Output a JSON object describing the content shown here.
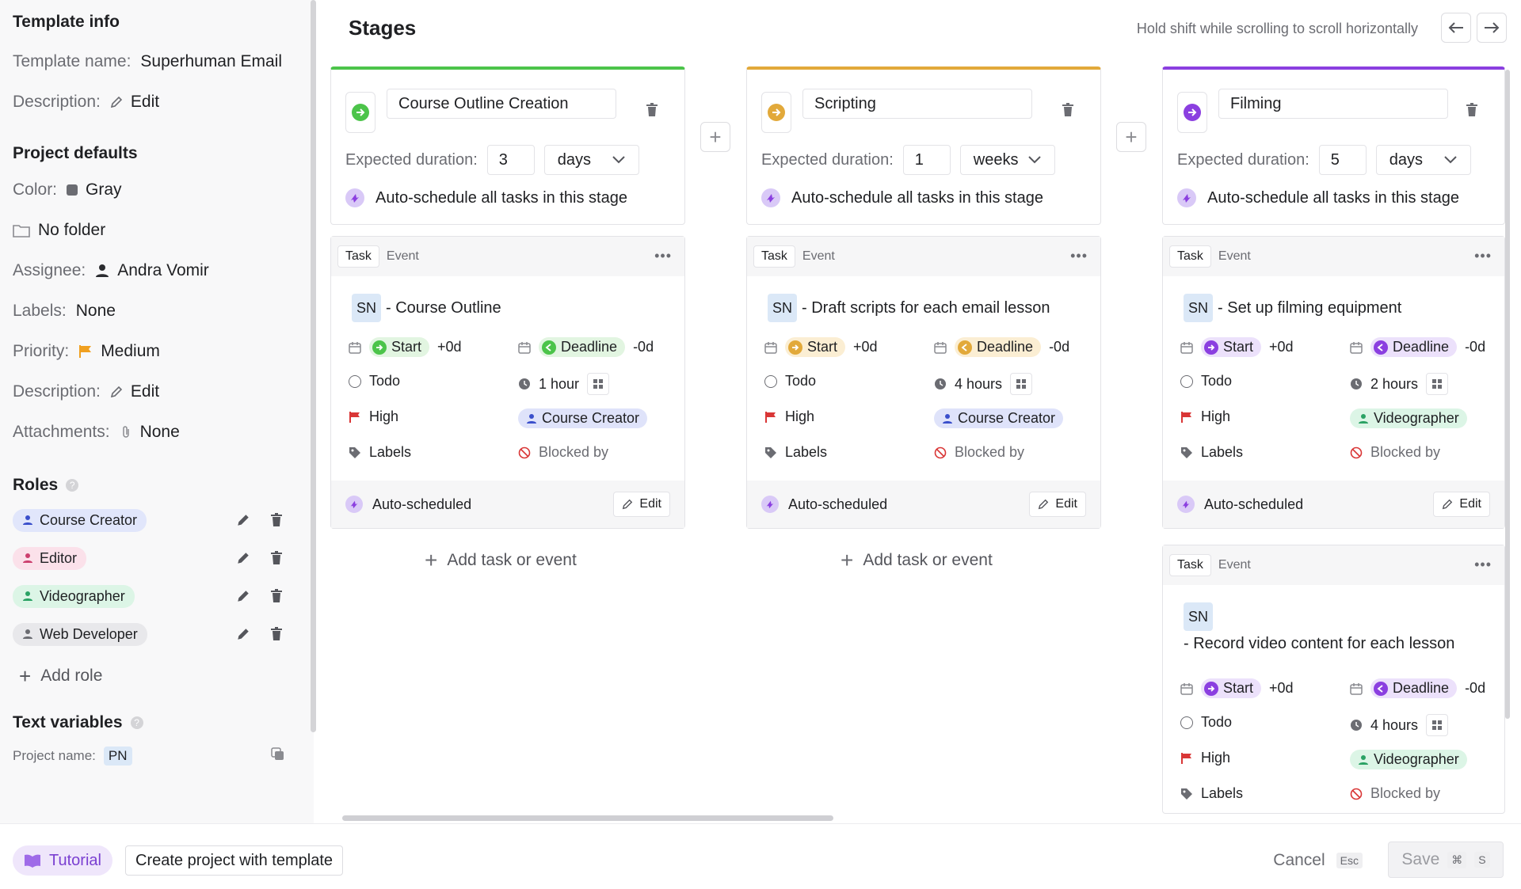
{
  "sidebar": {
    "template_info_heading": "Template info",
    "template_name_label": "Template name:",
    "template_name_value": "Superhuman Email",
    "description_label": "Description:",
    "description_edit": "Edit",
    "project_defaults_heading": "Project defaults",
    "color_label": "Color:",
    "color_value": "Gray",
    "folder_value": "No folder",
    "assignee_label": "Assignee:",
    "assignee_value": "Andra Vomir",
    "labels_label": "Labels:",
    "labels_value": "None",
    "priority_label": "Priority:",
    "priority_value": "Medium",
    "description2_label": "Description:",
    "description2_edit": "Edit",
    "attachments_label": "Attachments:",
    "attachments_value": "None",
    "roles_heading": "Roles",
    "roles": [
      {
        "name": "Course Creator",
        "bg": "#e1e6fb",
        "fg": "#3a4fcb"
      },
      {
        "name": "Editor",
        "bg": "#fbe1ea",
        "fg": "#cc3f6e"
      },
      {
        "name": "Videographer",
        "bg": "#dcf5e6",
        "fg": "#2aa264"
      },
      {
        "name": "Web Developer",
        "bg": "#e8e8eb",
        "fg": "#6b6c72"
      }
    ],
    "add_role": "Add role",
    "text_variables_heading": "Text variables",
    "project_name_label": "Project name:",
    "project_name_value": "PN"
  },
  "main": {
    "title": "Stages",
    "hint": "Hold shift while scrolling to scroll horizontally",
    "duration_label": "Expected duration:",
    "auto_schedule_text": "Auto-schedule all tasks in this stage",
    "add_task_label": "Add task or event",
    "task_tab": "Task",
    "event_tab": "Event",
    "stages": [
      {
        "name": "Course Outline Creation",
        "color": "#4cc44a",
        "duration": "3",
        "unit": "days",
        "cards": [
          {
            "sn": "SN",
            "title": "- Course Outline",
            "start": "Start",
            "start_off": "+0d",
            "deadline": "Deadline",
            "deadline_off": "-0d",
            "status": "Todo",
            "duration": "1 hour",
            "priority": "High",
            "role": "Course Creator",
            "labels": "Labels",
            "blocked": "Blocked by",
            "auto": "Auto-scheduled",
            "edit": "Edit"
          }
        ]
      },
      {
        "name": "Scripting",
        "color": "#e2a93a",
        "duration": "1",
        "unit": "weeks",
        "cards": [
          {
            "sn": "SN",
            "title": "- Draft scripts for each email lesson",
            "start": "Start",
            "start_off": "+0d",
            "deadline": "Deadline",
            "deadline_off": "-0d",
            "status": "Todo",
            "duration": "4 hours",
            "priority": "High",
            "role": "Course Creator",
            "labels": "Labels",
            "blocked": "Blocked by",
            "auto": "Auto-scheduled",
            "edit": "Edit"
          }
        ]
      },
      {
        "name": "Filming",
        "color": "#8b3fe0",
        "duration": "5",
        "unit": "days",
        "cards": [
          {
            "sn": "SN",
            "title": "- Set up filming equipment",
            "start": "Start",
            "start_off": "+0d",
            "deadline": "Deadline",
            "deadline_off": "-0d",
            "status": "Todo",
            "duration": "2 hours",
            "priority": "High",
            "role": "Videographer",
            "labels": "Labels",
            "blocked": "Blocked by",
            "auto": "Auto-scheduled",
            "edit": "Edit"
          },
          {
            "sn": "SN",
            "title": "- Record video content for each lesson",
            "start": "Start",
            "start_off": "+0d",
            "deadline": "Deadline",
            "deadline_off": "-0d",
            "status": "Todo",
            "duration": "4 hours",
            "priority": "High",
            "role": "Videographer",
            "labels": "Labels",
            "blocked": "Blocked by"
          }
        ]
      }
    ]
  },
  "footer": {
    "tutorial": "Tutorial",
    "create": "Create project with template",
    "cancel": "Cancel",
    "cancel_key": "Esc",
    "save": "Save",
    "save_key1": "⌘",
    "save_key2": "S"
  }
}
